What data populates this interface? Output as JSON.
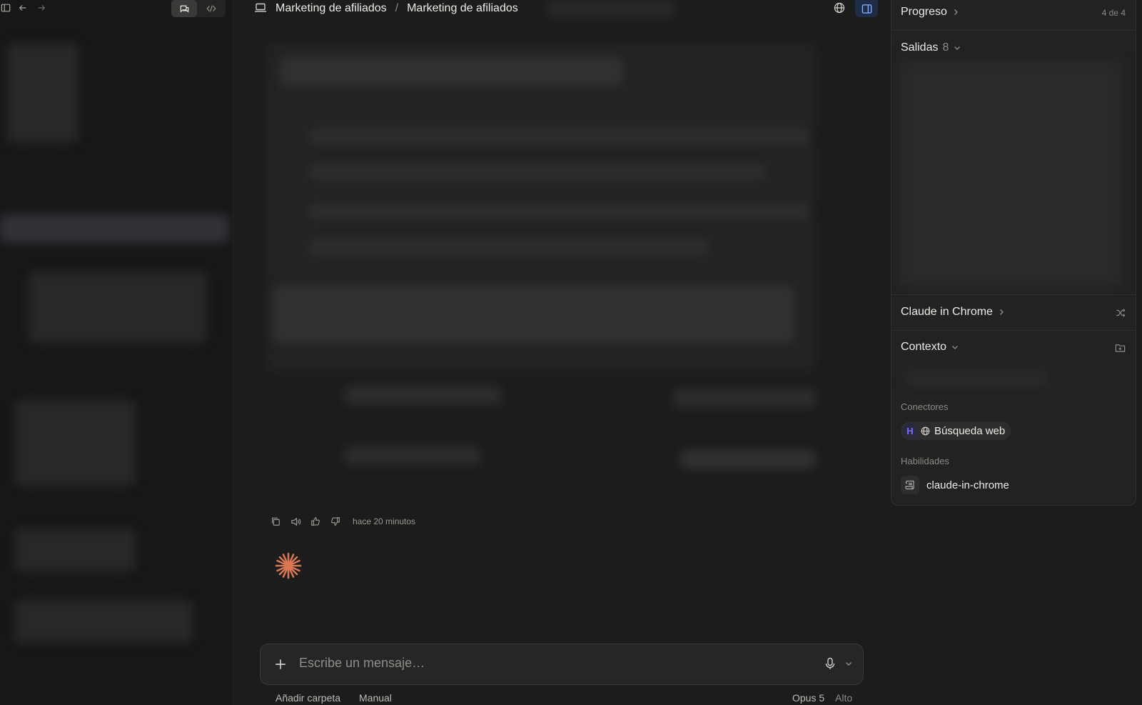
{
  "header": {
    "breadcrumb_project": "Marketing de afiliados",
    "breadcrumb_separator": "/",
    "breadcrumb_current": "Marketing de afiliados"
  },
  "message": {
    "timestamp": "hace 20 minutos"
  },
  "composer": {
    "placeholder": "Escribe un mensaje…",
    "add_folder": "Añadir carpeta",
    "mode": "Manual",
    "model": "Opus 5",
    "effort": "Alto"
  },
  "right_panel": {
    "progress_title": "Progreso",
    "progress_count": "4 de 4",
    "outputs_title": "Salidas",
    "outputs_count": "8",
    "chrome_title": "Claude in Chrome",
    "context_title": "Contexto",
    "connectors_label": "Conectores",
    "connector_name": "Búsqueda web",
    "skills_label": "Habilidades",
    "skill_name": "claude-in-chrome"
  },
  "icons": {
    "sidebar_toggle": "sidebar-toggle-icon",
    "back": "arrow-left-icon",
    "forward": "arrow-right-icon",
    "chat": "chat-icon",
    "code": "code-icon",
    "laptop": "laptop-icon",
    "globe": "globe-icon",
    "panel": "panel-right-icon"
  },
  "colors": {
    "accent_spark": "#d97757",
    "panel_button_bg": "#1f2c46"
  }
}
